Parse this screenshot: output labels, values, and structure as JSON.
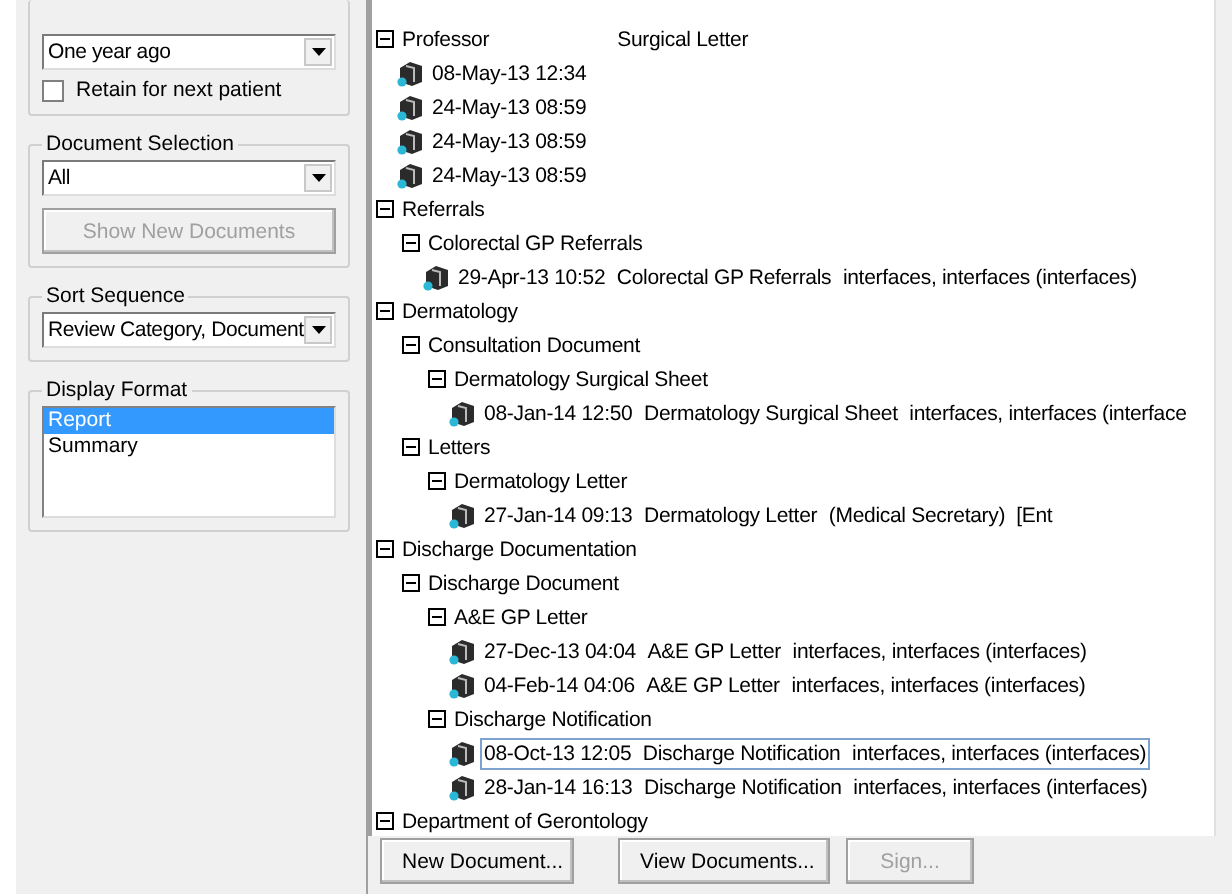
{
  "filters": {
    "period": {
      "value": "One year ago"
    },
    "retain": {
      "label": "Retain for next patient",
      "checked": false
    }
  },
  "document_selection": {
    "label": "Document Selection",
    "value": "All",
    "button": {
      "label": "Show New Documents",
      "disabled": true
    }
  },
  "sort_sequence": {
    "label": "Sort Sequence",
    "value": "Review Category, Document"
  },
  "display_format": {
    "label": "Display Format",
    "items": [
      {
        "label": "Report",
        "selected": true
      },
      {
        "label": "Summary",
        "selected": false
      }
    ]
  },
  "tree": {
    "nodes": [
      {
        "kind": "folder",
        "label": "Professor",
        "note": "Surgical Letter",
        "expanded": true,
        "children": [
          {
            "kind": "document",
            "date": "08-May-13 12:34",
            "selected": false
          },
          {
            "kind": "document",
            "date": "24-May-13 08:59",
            "selected": false
          },
          {
            "kind": "document",
            "date": "24-May-13 08:59",
            "selected": false
          },
          {
            "kind": "document",
            "date": "24-May-13 08:59",
            "selected": false
          }
        ]
      },
      {
        "kind": "folder",
        "label": "Referrals",
        "expanded": true,
        "children": [
          {
            "kind": "folder",
            "label": "Colorectal GP Referrals",
            "expanded": true,
            "children": [
              {
                "kind": "document",
                "date": "29-Apr-13 10:52",
                "title": "Colorectal GP Referrals",
                "author": "interfaces, interfaces (interfaces)",
                "selected": false
              }
            ]
          }
        ]
      },
      {
        "kind": "folder",
        "label": "Dermatology",
        "expanded": true,
        "children": [
          {
            "kind": "folder",
            "label": "Consultation Document",
            "expanded": true,
            "children": [
              {
                "kind": "folder",
                "label": "Dermatology Surgical Sheet",
                "expanded": true,
                "children": [
                  {
                    "kind": "document",
                    "date": "08-Jan-14 12:50",
                    "title": "Dermatology Surgical Sheet",
                    "author": "interfaces, interfaces (interface",
                    "selected": false
                  }
                ]
              }
            ]
          },
          {
            "kind": "folder",
            "label": "Letters",
            "expanded": true,
            "children": [
              {
                "kind": "folder",
                "label": "Dermatology Letter",
                "expanded": true,
                "children": [
                  {
                    "kind": "document",
                    "date": "27-Jan-14 09:13",
                    "title": "Dermatology Letter",
                    "author": "(Medical Secretary)  [Ent",
                    "selected": false
                  }
                ]
              }
            ]
          }
        ]
      },
      {
        "kind": "folder",
        "label": "Discharge Documentation",
        "expanded": true,
        "children": [
          {
            "kind": "folder",
            "label": "Discharge Document",
            "expanded": true,
            "children": [
              {
                "kind": "folder",
                "label": "A&E GP Letter",
                "expanded": true,
                "children": [
                  {
                    "kind": "document",
                    "date": "27-Dec-13 04:04",
                    "title": "A&E GP Letter",
                    "author": "interfaces, interfaces (interfaces)",
                    "selected": false
                  },
                  {
                    "kind": "document",
                    "date": "04-Feb-14 04:06",
                    "title": "A&E GP Letter",
                    "author": "interfaces, interfaces (interfaces)",
                    "selected": false
                  }
                ]
              },
              {
                "kind": "folder",
                "label": "Discharge Notification",
                "expanded": true,
                "children": [
                  {
                    "kind": "document",
                    "date": "08-Oct-13 12:05",
                    "title": "Discharge Notification",
                    "author": "interfaces, interfaces (interfaces)",
                    "selected": true
                  },
                  {
                    "kind": "document",
                    "date": "28-Jan-14 16:13",
                    "title": "Discharge Notification",
                    "author": "interfaces, interfaces (interfaces)",
                    "selected": false
                  }
                ]
              }
            ]
          }
        ]
      },
      {
        "kind": "folder",
        "label": "Department of Gerontology",
        "expanded": true
      }
    ]
  },
  "buttons": [
    {
      "label": "New Document...",
      "disabled": false
    },
    {
      "label": "View Documents...",
      "disabled": false
    },
    {
      "label": "Sign...",
      "disabled": true
    }
  ]
}
